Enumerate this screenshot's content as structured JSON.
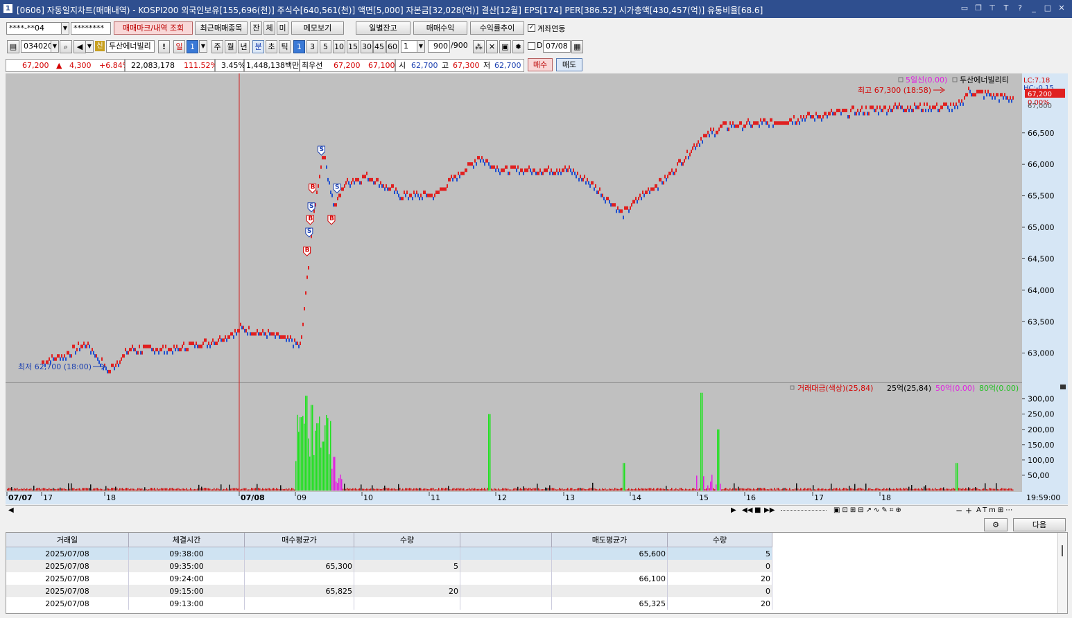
{
  "window": {
    "number": "1",
    "title": "[0606] 자동일지차트(매매내역) - KOSPI200 외국인보유[155,696(천)] 주식수[640,561(천)] 액면[5,000] 자본금[32,028(억)] 결산[12월] EPS[174] PER[386.52] 시가총액[430,457(억)] 유통비율[68.6]"
  },
  "toolbar1": {
    "account": "****-**04",
    "password": "********",
    "btn_mark": "매매마크/내역 조회",
    "btn_recent": "최근매매종목",
    "btn_jan": "잔",
    "btn_che": "체",
    "btn_mi": "미",
    "btn_memo": "메모보기",
    "btn_daily_balance": "일별잔고",
    "btn_trade_profit": "매매수익",
    "btn_return_trend": "수익률추이",
    "account_link_label": "계좌연동"
  },
  "toolbar2": {
    "code": "034020",
    "credit_badge": "신",
    "stock_name": "두산에너빌리",
    "warn": "!",
    "period_day": "일",
    "period_value": "1",
    "week": "주",
    "month": "월",
    "year": "년",
    "minute": "분",
    "second": "초",
    "tick": "틱",
    "intervals": [
      "1",
      "3",
      "5",
      "10",
      "15",
      "30",
      "45",
      "60"
    ],
    "interval_select": "1",
    "count": "900",
    "count_total": "/900",
    "d_label": "D",
    "date": "07/08"
  },
  "quote": {
    "price": "67,200",
    "arrow": "▲",
    "change": "4,300",
    "change_pct": "+6.84%",
    "volume": "22,083,178",
    "vol_ratio": "111.52%",
    "turnover": "3.45%",
    "amount": "1,448,138백만",
    "best_label": "최우선",
    "best_ask": "67,200",
    "best_bid": "67,100",
    "open_label": "시",
    "open": "62,700",
    "high_label": "고",
    "high": "67,300",
    "low_label": "저",
    "low": "62,700",
    "buy_btn": "매수",
    "sell_btn": "매도"
  },
  "chart": {
    "ma_label": "5일선(0.00)",
    "stock_label": "두산에너빌리티",
    "lc_label": "LC:7.18",
    "hc_label": "HC:-0.15",
    "current_price_tag": "67,200",
    "current_pct_tag": "0.00%",
    "high_annotation": "최고 67,300 (18:58)",
    "low_annotation": "최저 62,700 (18:00)",
    "vol_legend": [
      "거래대금(색상)(25,84)",
      "25억(25,84)",
      "50억(0.00)",
      "80억(0.00)"
    ],
    "x_labels": [
      "07/07",
      "17",
      "18",
      "07/08",
      "09",
      "10",
      "11",
      "12",
      "13",
      "14",
      "15",
      "16",
      "17",
      "18"
    ],
    "time_label": "19:59:00",
    "hidden_axis_label": "67,000",
    "colors": {
      "up": "#e02020",
      "down": "#1f4fd0",
      "bg": "#c0c0c0",
      "axis_bg": "#d6e6f5",
      "vol_green": "#22e022",
      "vol_magenta": "#e020e0"
    }
  },
  "chart_data": [
    {
      "type": "candlestick",
      "title": "",
      "y_ticks": [
        "63,000",
        "63,500",
        "64,000",
        "64,500",
        "65,000",
        "65,500",
        "66,000",
        "66,500"
      ],
      "ylim": [
        62600,
        67400
      ],
      "price_path": [
        {
          "t": "07/07 17:00",
          "price": 62850
        },
        {
          "t": "07/07 17:20",
          "price": 62950
        },
        {
          "t": "07/07 17:40",
          "price": 63150
        },
        {
          "t": "07/07 18:00",
          "price": 62700
        },
        {
          "t": "07/07 18:20",
          "price": 63050
        },
        {
          "t": "07/07 19:00",
          "price": 63050
        },
        {
          "t": "07/07 19:40",
          "price": 63200
        },
        {
          "t": "07/07 20:00",
          "price": 63350
        },
        {
          "t": "07/08 08:00",
          "price": 63400
        },
        {
          "t": "07/08 08:50",
          "price": 63200
        },
        {
          "t": "07/08 09:00",
          "price": 63100
        },
        {
          "t": "07/08 09:10",
          "price": 65000
        },
        {
          "t": "07/08 09:20",
          "price": 66200
        },
        {
          "t": "07/08 09:30",
          "price": 65300
        },
        {
          "t": "07/08 09:40",
          "price": 65700
        },
        {
          "t": "07/08 10:00",
          "price": 65800
        },
        {
          "t": "07/08 10:30",
          "price": 65500
        },
        {
          "t": "07/08 11:00",
          "price": 65500
        },
        {
          "t": "07/08 11:40",
          "price": 66100
        },
        {
          "t": "07/08 12:00",
          "price": 65900
        },
        {
          "t": "07/08 12:30",
          "price": 65900
        },
        {
          "t": "07/08 13:00",
          "price": 65900
        },
        {
          "t": "07/08 13:20",
          "price": 65700
        },
        {
          "t": "07/08 13:50",
          "price": 65200
        },
        {
          "t": "07/08 14:00",
          "price": 65400
        },
        {
          "t": "07/08 14:30",
          "price": 65800
        },
        {
          "t": "07/08 15:00",
          "price": 66400
        },
        {
          "t": "07/08 15:20",
          "price": 66600
        },
        {
          "t": "07/08 16:00",
          "price": 66650
        },
        {
          "t": "07/08 17:00",
          "price": 66800
        },
        {
          "t": "07/08 18:00",
          "price": 66900
        },
        {
          "t": "07/08 18:50",
          "price": 66900
        },
        {
          "t": "07/08 19:00",
          "price": 67150
        },
        {
          "t": "07/08 19:50",
          "price": 67000
        },
        {
          "t": "07/08 19:59",
          "price": 67200
        }
      ],
      "trade_marks": [
        {
          "type": "B",
          "t": "07/08 09:06",
          "price": 64600
        },
        {
          "type": "S",
          "t": "07/08 09:08",
          "price": 64900
        },
        {
          "type": "B",
          "t": "07/08 09:09",
          "price": 65100
        },
        {
          "type": "S",
          "t": "07/08 09:10",
          "price": 65300
        },
        {
          "type": "B",
          "t": "07/08 09:11",
          "price": 65600
        },
        {
          "type": "S",
          "t": "07/08 09:19",
          "price": 66200
        },
        {
          "type": "B",
          "t": "07/08 09:28",
          "price": 65100
        },
        {
          "type": "S",
          "t": "07/08 09:33",
          "price": 65600
        }
      ]
    },
    {
      "type": "bar",
      "title": "",
      "y_ticks": [
        "50,00",
        "100,00",
        "150,00",
        "200,00",
        "250,00",
        "300,00"
      ],
      "ylim": [
        0,
        340
      ],
      "spikes": [
        {
          "t": "07/08 09:00",
          "value": 240
        },
        {
          "t": "07/08 09:05",
          "value": 310
        },
        {
          "t": "07/08 09:10",
          "value": 280
        },
        {
          "t": "07/08 09:15",
          "value": 220
        },
        {
          "t": "07/08 09:20",
          "value": 160
        },
        {
          "t": "07/08 09:30",
          "value": 110
        },
        {
          "t": "07/08 11:50",
          "value": 250
        },
        {
          "t": "07/08 13:50",
          "value": 90
        },
        {
          "t": "07/08 15:00",
          "value": 320
        },
        {
          "t": "07/08 15:15",
          "value": 200
        },
        {
          "t": "07/08 18:50",
          "value": 90
        }
      ]
    }
  ],
  "bottom": {
    "settings_icon": "gear-icon",
    "next_btn": "다음"
  },
  "table": {
    "headers": [
      "거래일",
      "체결시간",
      "매수평균가",
      "수량",
      "",
      "매도평균가",
      "수량"
    ],
    "rows": [
      [
        "2025/07/08",
        "09:38:00",
        "",
        "",
        "",
        "65,600",
        "5"
      ],
      [
        "2025/07/08",
        "09:35:00",
        "65,300",
        "5",
        "",
        "",
        "0"
      ],
      [
        "2025/07/08",
        "09:24:00",
        "",
        "",
        "",
        "66,100",
        "20"
      ],
      [
        "2025/07/08",
        "09:15:00",
        "65,825",
        "20",
        "",
        "",
        "0"
      ],
      [
        "2025/07/08",
        "09:13:00",
        "",
        "",
        "",
        "65,325",
        "20"
      ]
    ]
  }
}
